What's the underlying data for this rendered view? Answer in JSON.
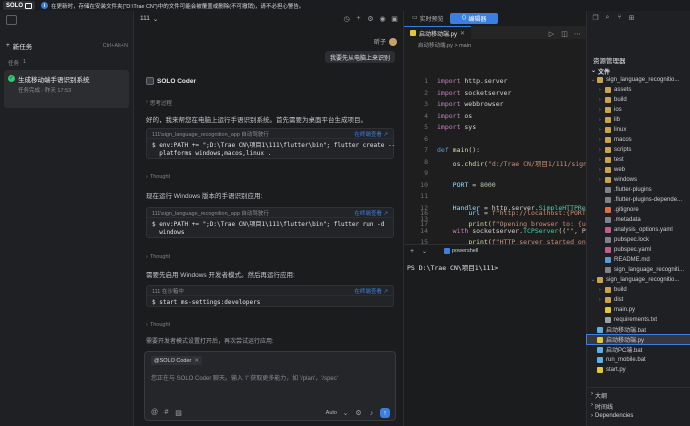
{
  "app": {
    "logo": "SOLO",
    "notice": "在更新时，存储在安装文件夹(\"D:\\Trae CN\")中的文件可能会被覆盖或删除(不可撤销)，请不必担心警告。"
  },
  "left": {
    "new_task": "新任务",
    "shortcut": "Ctrl+Alt+N",
    "tasks_label": "任务",
    "tasks_count": "1",
    "task_title": "生成移动端手语识别系统",
    "task_meta": "任务完成 · 昨天 17:53"
  },
  "chat": {
    "tab": "111",
    "user_name": "昕子",
    "user_msg": "我要先从电脑上来识别",
    "agent_name": "SOLO Coder",
    "thinking_label": "思考过程",
    "para1": "好的，我来帮您在电脑上运行手语识别系统。首先需要为桌面平台生成项目。",
    "cb1_path": "111\\sign_language_recognition_app  自动驾驶行",
    "cb1_action": "在终端查看 ↗",
    "cb1_code": "$ env:PATH += \";D:\\Trae CN\\项目1\\111\\flutter\\bin\"; flutter create --\n  platforms windows,macos,linux .",
    "thought": "Thought",
    "para2": "现在运行 Windows 版本的手语识别应用:",
    "cb2_path": "111\\sign_language_recognition_app  自动驾驶行",
    "cb2_action": "在终端查看 ↗",
    "cb2_code": "$ env:PATH += \";D:\\Trae CN\\项目1\\111\\flutter\\bin\"; flutter run -d\n  windows",
    "para3": "需要先启用 Windows 开发者模式。然后再运行应用:",
    "cb3_path": "111  在沙箱中",
    "cb3_action": "在终端查看 ↗",
    "cb3_code": "$ start ms-settings:developers",
    "para4": "需要开发者模式设置打开后，再次尝试运行应用:",
    "input_mention": "@SOLO Coder",
    "input_placeholder": "您正在与 SOLO Coder 聊天。输入 '/' 获取更多能力，如 '/plan'，'/spec'",
    "mode": "Auto"
  },
  "editor": {
    "tab1": "实时预览",
    "tab2": "编辑器",
    "file_tab": "启动移动端.py",
    "breadcrumb": "启动移动端.py > main",
    "terminal_tab": "powershell",
    "terminal_line": "PS D:\\Trae CN\\项目1\\111>"
  },
  "explorer": {
    "title": "资源管理器",
    "section": "文件",
    "outline": "大纲",
    "timeline": "时间线",
    "deps": "Dependencies",
    "items": [
      {
        "n": "sign_language_recognitio...",
        "k": "dir",
        "l": 1
      },
      {
        "n": "assets",
        "k": "dir",
        "l": 2
      },
      {
        "n": "build",
        "k": "dir",
        "l": 2
      },
      {
        "n": "ios",
        "k": "dir",
        "l": 2
      },
      {
        "n": "lib",
        "k": "dir",
        "l": 2
      },
      {
        "n": "linux",
        "k": "dir",
        "l": 2
      },
      {
        "n": "macos",
        "k": "dir",
        "l": 2
      },
      {
        "n": "scripts",
        "k": "dir",
        "l": 2
      },
      {
        "n": "test",
        "k": "dir",
        "l": 2
      },
      {
        "n": "web",
        "k": "dir",
        "l": 2
      },
      {
        "n": "windows",
        "k": "dir",
        "l": 2
      },
      {
        "n": ".flutter-plugins",
        "k": "file",
        "l": 2
      },
      {
        "n": ".flutter-plugins-depende...",
        "k": "file",
        "l": 2
      },
      {
        "n": ".gitignore",
        "k": "git",
        "l": 2
      },
      {
        "n": ".metadata",
        "k": "file",
        "l": 2
      },
      {
        "n": "analysis_options.yaml",
        "k": "yaml",
        "l": 2
      },
      {
        "n": "pubspec.lock",
        "k": "file",
        "l": 2
      },
      {
        "n": "pubspec.yaml",
        "k": "yaml",
        "l": 2
      },
      {
        "n": "README.md",
        "k": "md",
        "l": 2
      },
      {
        "n": "sign_language_recogniti...",
        "k": "file",
        "l": 2
      },
      {
        "n": "sign_language_recognitio...",
        "k": "dir",
        "l": 1
      },
      {
        "n": "build",
        "k": "dir",
        "l": 2
      },
      {
        "n": "dist",
        "k": "dir",
        "l": 2
      },
      {
        "n": "main.py",
        "k": "py",
        "l": 2
      },
      {
        "n": "requirements.txt",
        "k": "txt",
        "l": 2
      },
      {
        "n": "启动移动端.bat",
        "k": "bat",
        "l": 1
      },
      {
        "n": "启动移动端.py",
        "k": "py",
        "l": 1,
        "sel": true
      },
      {
        "n": "启动PC端.bat",
        "k": "bat",
        "l": 1
      },
      {
        "n": "run_mobile.bat",
        "k": "bat",
        "l": 1
      },
      {
        "n": "start.py",
        "k": "py",
        "l": 1
      }
    ]
  },
  "colors": {
    "accent": "#3b7fe0",
    "success": "#2ecc71",
    "selection": "#37373d"
  }
}
